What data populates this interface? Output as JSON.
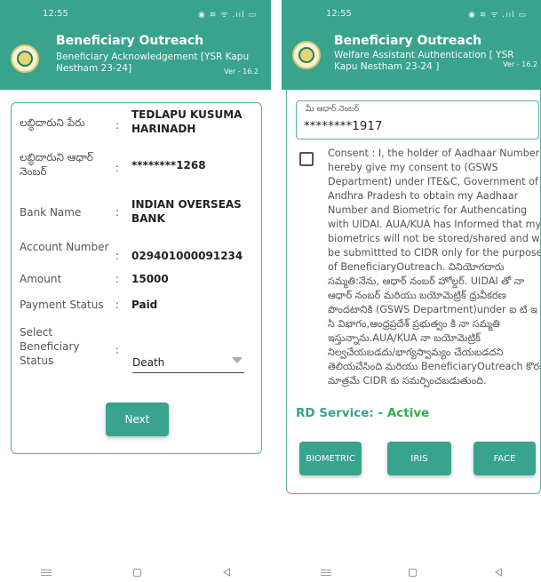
{
  "screen1": {
    "status": {
      "time": "12:55",
      "icons": "◉ ≋ ᯤ .ııl ▭"
    },
    "header": {
      "title": "Beneficiary Outreach",
      "subtitle": "Beneficiary Acknowledgement [YSR Kapu Nestham 23-24]",
      "version": "Ver - 16.2"
    },
    "rows": [
      {
        "label": "లబ్ధిదారుని పేరు",
        "value": "TEDLAPU KUSUMA HARINADH"
      },
      {
        "label": "లబ్ధిదారుని ఆధార్ నెంబర్",
        "value": "********1268"
      },
      {
        "label": "Bank Name",
        "value": "INDIAN OVERSEAS BANK"
      },
      {
        "label": "Account Number",
        "value": "029401000091234"
      },
      {
        "label": "Amount",
        "value": "15000"
      },
      {
        "label": "Payment Status",
        "value": "Paid"
      },
      {
        "label": "Select Beneficiary Status",
        "value": "Death"
      }
    ],
    "colon": ":",
    "next_label": "Next"
  },
  "screen2": {
    "status": {
      "time": "12:55",
      "icons": "◉ ≋ ᯤ .ııl ▭"
    },
    "header": {
      "title": "Beneficiary Outreach",
      "subtitle": "Welfare Assistant Authentication [ YSR Kapu Nestham 23-24 ]",
      "version": "Ver - 16.2"
    },
    "aadhaar": {
      "label": "మీ ఆధార్ నెంబర్",
      "value": "********1917"
    },
    "consent_checked": false,
    "consent_text": "Consent : I, the holder of Aadhaar Number, hereby give my consent to (GSWS Department) under ITE&C, Government of Andhra Pradesh to obtain my Aadhaar Number and Biometric for Authencating with UIDAI. AUA/KUA has Informed that my biometrics will not be stored/shared and will be submittted to CIDR only for the purpose of BeneficiaryOutreach. వినియోగదారు సమ్మతి:నేను, ఆధార్ నంబర్ హోల్డర్. UIDAI తో నా ఆధార్ నంబర్ మరియు బయోమెట్రిక్ ధ్రువీకరణ పొందటానికి (GSWS Department)under ఐ టి ఇ & సి విభాగం,ఆంధ్రప్రదేశ్ ప్రభుత్వం కి నా సమ్మతి ఇస్తున్నాను.AUA/KUA నా బయోమెట్రిక్ నిల్వచేయబడదు/భాగ్యస్వామ్యం చేయబడదని తెలియచేసింది మరియు BeneficiaryOutreach కొరకు మాత్రమే CIDR కు సమర్పించబడుతుంది.",
    "rd_label": "RD Service: - ",
    "rd_status": "Active",
    "buttons": {
      "biometric": "BIOMETRIC",
      "iris": "IRIS",
      "face": "FACE"
    }
  },
  "colors": {
    "header": "#3aa38e",
    "active": "#2fb14a",
    "border": "#58b4a2"
  }
}
